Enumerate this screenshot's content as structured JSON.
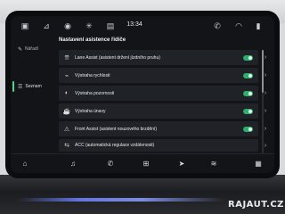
{
  "status_bar": {
    "time": "13:34",
    "icons": [
      "car-icon",
      "seat-icon",
      "assist-icon",
      "climate-icon",
      "camera-icon",
      "phone-icon",
      "wifi-icon",
      "signal-icon"
    ]
  },
  "sidebar": {
    "items": [
      {
        "label": "Nářadí",
        "icon": "tool-icon"
      },
      {
        "label": "Seznam",
        "icon": "list-icon",
        "active": true
      }
    ]
  },
  "page": {
    "title": "Nastavení asistence řidiče"
  },
  "settings": [
    {
      "label": "Lane Assist (asistent držení jízdního pruhu)",
      "icon": "lane-icon",
      "enabled": true
    },
    {
      "label": "Výstraha rychlosti",
      "icon": "speed-icon",
      "enabled": true
    },
    {
      "label": "Výstraha pozornosti",
      "icon": "eye-icon",
      "enabled": true
    },
    {
      "label": "Výstraha únavy",
      "icon": "coffee-icon",
      "enabled": true
    },
    {
      "label": "Front Assist (asistent nouzového brzdění)",
      "icon": "front-assist-icon",
      "enabled": true
    },
    {
      "label": "ACC (automatická regulace vzdálenosti)",
      "icon": "acc-icon",
      "enabled": false
    }
  ],
  "dock": {
    "icons": [
      "home-icon",
      "music-icon",
      "phone-icon",
      "apps-icon",
      "navigation-icon",
      "media-icon",
      "grid-icon"
    ]
  },
  "colors": {
    "accent": "#2fae6b",
    "screen_bg": "#121417",
    "row_bg": "#1f2226"
  },
  "watermark": "RAJAUT.CZ"
}
